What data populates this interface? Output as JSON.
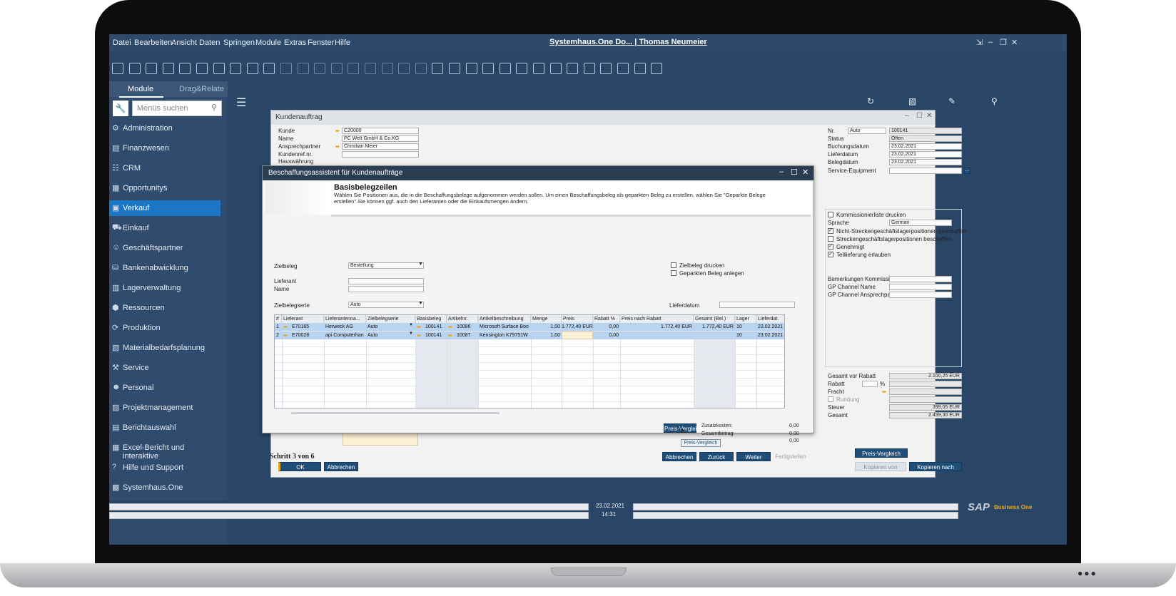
{
  "menu": {
    "items": [
      "Datei",
      "Bearbeiten",
      "Ansicht",
      "Daten",
      "Springen",
      "Module",
      "Extras",
      "Fenster",
      "Hilfe"
    ],
    "title": "Systemhaus.One Do... | Thomas Neumeier"
  },
  "left_panel": {
    "tab_modules": "Module",
    "tab_drag": "Drag&Relate",
    "search_placeholder": "Menüs suchen",
    "items": [
      {
        "label": "Administration",
        "icon": "admin-icon"
      },
      {
        "label": "Finanzwesen",
        "icon": "finance-icon"
      },
      {
        "label": "CRM",
        "icon": "crm-icon"
      },
      {
        "label": "Opportunitys",
        "icon": "opportunity-icon"
      },
      {
        "label": "Verkauf",
        "icon": "sales-icon",
        "selected": true
      },
      {
        "label": "Einkauf",
        "icon": "cart-icon"
      },
      {
        "label": "Geschäftspartner",
        "icon": "partner-icon"
      },
      {
        "label": "Bankenabwicklung",
        "icon": "bank-icon"
      },
      {
        "label": "Lagerverwaltung",
        "icon": "warehouse-icon"
      },
      {
        "label": "Ressourcen",
        "icon": "resource-icon"
      },
      {
        "label": "Produktion",
        "icon": "production-icon"
      },
      {
        "label": "Materialbedarfsplanung",
        "icon": "mrp-icon"
      },
      {
        "label": "Service",
        "icon": "service-icon"
      },
      {
        "label": "Personal",
        "icon": "person-icon"
      },
      {
        "label": "Projektmanagement",
        "icon": "project-icon"
      },
      {
        "label": "Berichtauswahl",
        "icon": "report-icon"
      },
      {
        "label": "Excel-Bericht und interaktive",
        "icon": "excel-icon"
      },
      {
        "label": "Hilfe und Support",
        "icon": "help-icon"
      },
      {
        "label": "Systemhaus.One",
        "icon": "systemhaus-icon"
      }
    ]
  },
  "order": {
    "title": "Kundenauftrag",
    "kunde_label": "Kunde",
    "kunde_value": "C20000",
    "name_label": "Name",
    "name_value": "PC Welt GmbH & Co.KG",
    "ansprech_label": "Ansprechpartner",
    "ansprech_value": "Christian Meier",
    "kundenref_label": "Kundenref.nr.",
    "hauswaehrung_label": "Hauswährung",
    "nr_label": "Nr.",
    "nr_series": "Auto",
    "nr_value": "100141",
    "status_label": "Status",
    "status_value": "Offen",
    "buchung_label": "Buchungsdatum",
    "buchung_value": "23.02.2021",
    "liefer_label": "Lieferdatum",
    "liefer_value": "23.02.2021",
    "beleg_label": "Belegdatum",
    "beleg_value": "23.02.2021",
    "service_label": "Service-Equipment",
    "opt_kommissionierliste": "Kommissionierliste drucken",
    "sprache_label": "Sprache",
    "sprache_value": "German",
    "opt_nicht_strecken": "Nicht-Streckengeschäftslagerpositionen beschaffen",
    "opt_strecken": "Streckengeschäftslagerpositionen beschaffen",
    "opt_genehmigt": "Genehmigt",
    "opt_teillieferung": "Teillieferung erlauben",
    "bem_label": "Bemerkungen Kommission",
    "gp_name_label": "GP Channel Name",
    "gp_ansprech_label": "GP Channel Ansprechpart",
    "gesamt_vor_label": "Gesamt vor Rabatt",
    "gesamt_vor_value": "2.100,25 EUR",
    "rabatt_label": "Rabatt",
    "rabatt_unit": "%",
    "fracht_label": "Fracht",
    "rundung_label": "Rundung",
    "steuer_label": "Steuer",
    "steuer_value": "399,05 EUR",
    "gesamt_label": "Gesamt",
    "gesamt_value": "2.499,30 EUR",
    "btn_preisvergleich": "Preis-Vergleich",
    "btn_kopieren_von": "Kopieren von",
    "btn_kopieren_nach": "Kopieren nach",
    "btn_ok": "OK",
    "btn_abbrechen": "Abbrechen"
  },
  "wizard": {
    "title": "Beschaffungsassistent für Kundenaufträge",
    "heading": "Basisbelegzeilen",
    "description": "Wählen Sie Positionen aus, die in die Beschaffungsbelege aufgenommen werden sollen. Um einen Beschaffungsbeleg als geparkten Beleg zu erstellen, wählen Sie \"Geparkte Belege erstellen\".Sie können ggf. auch den Lieferanten oder die Einkaufsmengen ändern.",
    "zielbeleg_label": "Zielbeleg",
    "zielbeleg_value": "Bestellung",
    "lieferant_label": "Lieferant",
    "name_label": "Name",
    "zielbelegserie_label": "Zielbelegserie",
    "zielbelegserie_value": "Auto",
    "opt_drucken": "Zielbeleg drucken",
    "opt_geparkt": "Geparkten Beleg anlegen",
    "lieferdatum_label": "Lieferdatum",
    "columns": [
      "#",
      "Lieferant",
      "Lieferantenna...",
      "Zielbelegserie",
      "Basisbeleg",
      "Artikelnr.",
      "Artikelbeschreibung",
      "Menge",
      "Preis",
      "Rabatt %",
      "Preis nach Rabatt",
      "Gesamt (Bel.)",
      "Lager",
      "Lieferdat."
    ],
    "rows": [
      [
        "1",
        "E70165",
        "Herweck AG",
        "Auto",
        "100141",
        "10086",
        "Microsoft Surface Boo",
        "1,00",
        "1.772,40 EUR",
        "0,00",
        "1.772,40 EUR",
        "1.772,40 EUR",
        "10",
        "23.02.2021"
      ],
      [
        "2",
        "E70028",
        "api Computerhan",
        "Auto",
        "100141",
        "10087",
        "Kensington K79751W",
        "1,00",
        "",
        "0,00",
        "",
        "",
        "10",
        "23.02.2021"
      ]
    ],
    "btn_preisvergleich": "Preis-Vergleich",
    "tooltip": "Preis-Vergleich",
    "zusatz_label": "Zusatzkosten:",
    "zusatz_value": "0,00",
    "gesamtbetrag_label": "Gesamtbetrag:",
    "gesamtbetrag_value": "0,00",
    "third_value": "0,00",
    "step": "Schritt 3 von 6",
    "btn_abbrechen": "Abbrechen",
    "btn_zurueck": "Zurück",
    "btn_weiter": "Weiter",
    "btn_fertig": "Fertigstellen"
  },
  "status": {
    "date": "23.02.2021",
    "time": "14:31",
    "brand": "SAP",
    "brand_sub": "Business One"
  },
  "colors": {
    "accent": "#1c75c5",
    "dark_header": "#2b3d52",
    "bg": "#2a4666",
    "arrow": "#e8a317"
  }
}
